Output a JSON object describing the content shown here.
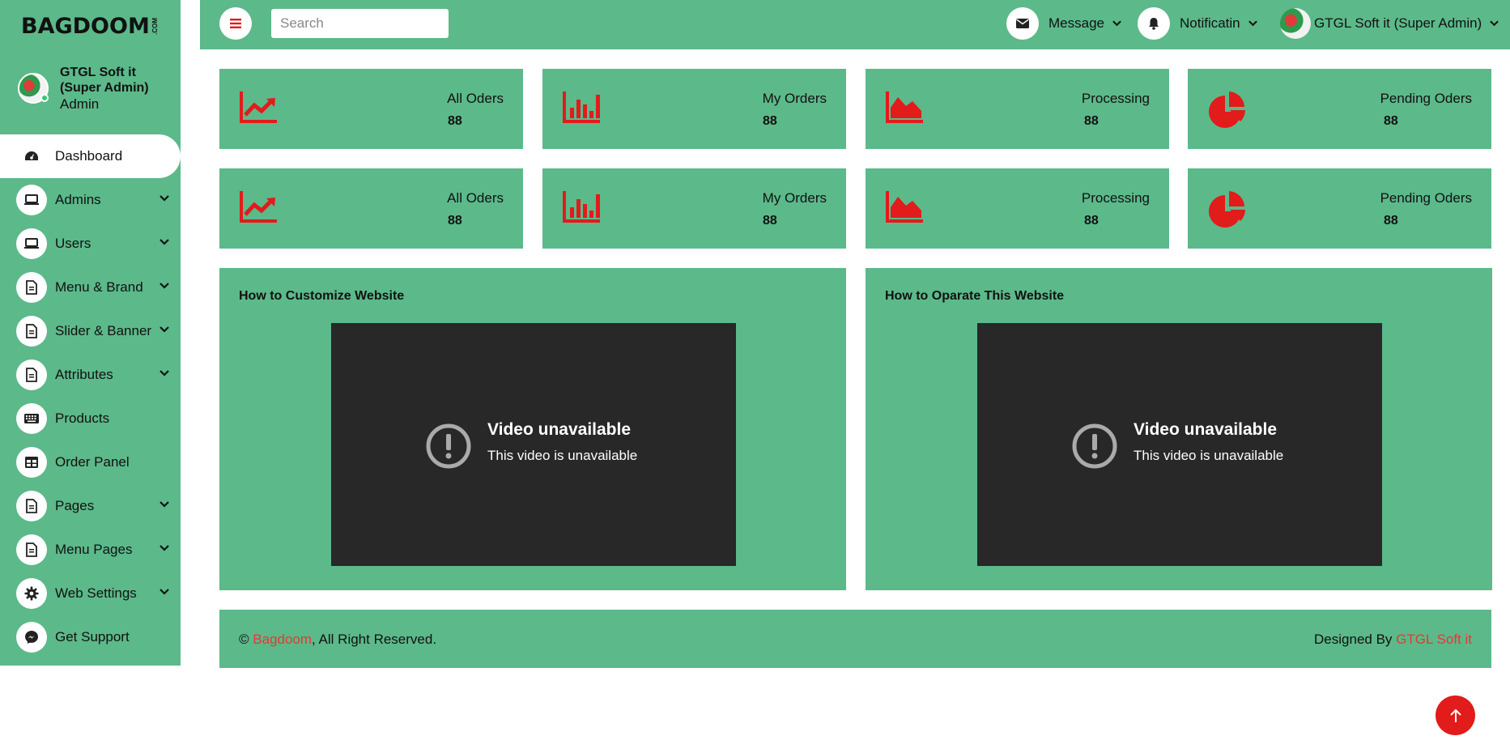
{
  "brand": {
    "name": "BAGDOOM",
    "suffix": ".COM"
  },
  "profile": {
    "name": "GTGL Soft it (Super Admin)",
    "role": "Admin"
  },
  "sidebar": {
    "items": [
      {
        "label": "Dashboard",
        "icon": "dashboard-icon",
        "active": true,
        "expandable": false
      },
      {
        "label": "Admins",
        "icon": "laptop-icon",
        "active": false,
        "expandable": true
      },
      {
        "label": "Users",
        "icon": "laptop-icon",
        "active": false,
        "expandable": true
      },
      {
        "label": "Menu & Brand",
        "icon": "document-icon",
        "active": false,
        "expandable": true
      },
      {
        "label": "Slider & Banner",
        "icon": "document-icon",
        "active": false,
        "expandable": true
      },
      {
        "label": "Attributes",
        "icon": "document-icon",
        "active": false,
        "expandable": true
      },
      {
        "label": "Products",
        "icon": "keyboard-icon",
        "active": false,
        "expandable": false
      },
      {
        "label": "Order Panel",
        "icon": "table-icon",
        "active": false,
        "expandable": false
      },
      {
        "label": "Pages",
        "icon": "document-icon",
        "active": false,
        "expandable": true
      },
      {
        "label": "Menu Pages",
        "icon": "document-icon",
        "active": false,
        "expandable": true
      },
      {
        "label": "Web Settings",
        "icon": "gear-icon",
        "active": false,
        "expandable": true
      },
      {
        "label": "Get Support",
        "icon": "messenger-icon",
        "active": false,
        "expandable": false
      }
    ]
  },
  "topbar": {
    "search_placeholder": "Search",
    "message_label": "Message",
    "notification_label": "Notificatin",
    "user_label": "GTGL Soft it (Super Admin)"
  },
  "stats": [
    {
      "label": "All Oders",
      "value": "88",
      "icon": "trend-up-icon"
    },
    {
      "label": "My Orders",
      "value": "88",
      "icon": "bar-chart-icon"
    },
    {
      "label": "Processing",
      "value": "88",
      "icon": "area-chart-icon"
    },
    {
      "label": "Pending Oders",
      "value": "88",
      "icon": "pie-chart-icon"
    },
    {
      "label": "All Oders",
      "value": "88",
      "icon": "trend-up-icon"
    },
    {
      "label": "My Orders",
      "value": "88",
      "icon": "bar-chart-icon"
    },
    {
      "label": "Processing",
      "value": "88",
      "icon": "area-chart-icon"
    },
    {
      "label": "Pending Oders",
      "value": "88",
      "icon": "pie-chart-icon"
    }
  ],
  "panels": [
    {
      "title": "How to Customize Website",
      "video_title": "Video unavailable",
      "video_sub": "This video is unavailable"
    },
    {
      "title": "How to Oparate This Website",
      "video_title": "Video unavailable",
      "video_sub": "This video is unavailable"
    }
  ],
  "footer": {
    "copyright_symbol": "©",
    "brand_link": "Bagdoom",
    "rights": ", All Right Reserved.",
    "designed_by": "Designed By ",
    "designer_link": "GTGL Soft it"
  },
  "colors": {
    "accent": "#5cb98a",
    "icon_red": "#e21b1b",
    "link_red": "#e53935",
    "video_bg": "#282828"
  }
}
